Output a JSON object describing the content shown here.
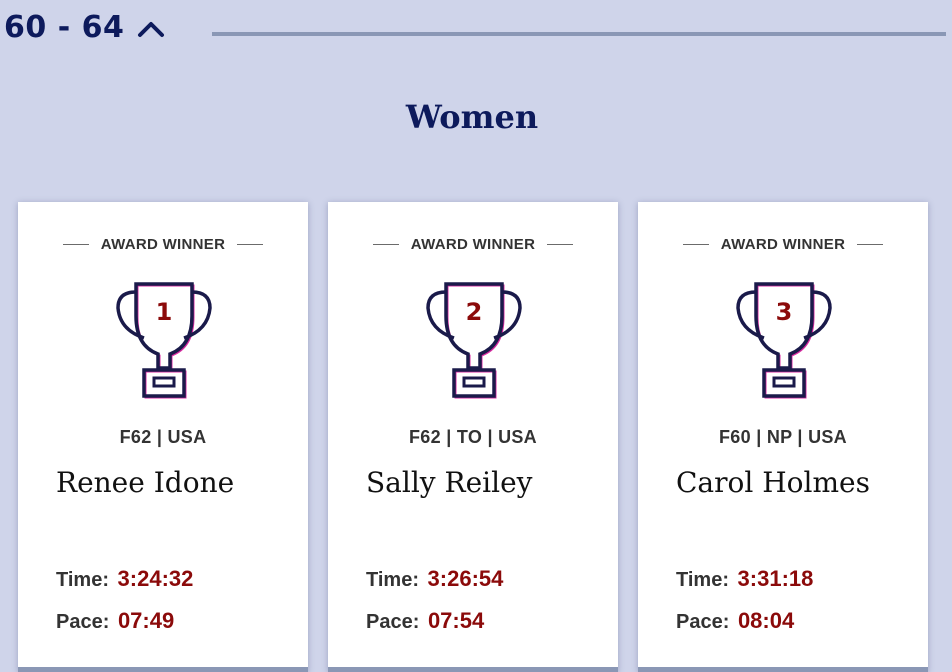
{
  "age_group": {
    "label": "60 - 64"
  },
  "section": {
    "title": "Women"
  },
  "winners": [
    {
      "award": "AWARD WINNER",
      "rank": "1",
      "meta": "F62 | USA",
      "name": "Renee Idone",
      "time_label": "Time:",
      "time": "3:24:32",
      "pace_label": "Pace:",
      "pace": "07:49"
    },
    {
      "award": "AWARD WINNER",
      "rank": "2",
      "meta": "F62 | TO | USA",
      "name": "Sally Reiley",
      "time_label": "Time:",
      "time": "3:26:54",
      "pace_label": "Pace:",
      "pace": "07:54"
    },
    {
      "award": "AWARD WINNER",
      "rank": "3",
      "meta": "F60 | NP | USA",
      "name": "Carol Holmes",
      "time_label": "Time:",
      "time": "3:31:18",
      "pace_label": "Pace:",
      "pace": "08:04"
    }
  ],
  "icons": {
    "collapse": "chevron-up-icon",
    "trophy": "trophy-icon"
  },
  "colors": {
    "navy": "#0d1a5c",
    "accent_red": "#8b0a0a",
    "background": "#cfd4ea"
  }
}
